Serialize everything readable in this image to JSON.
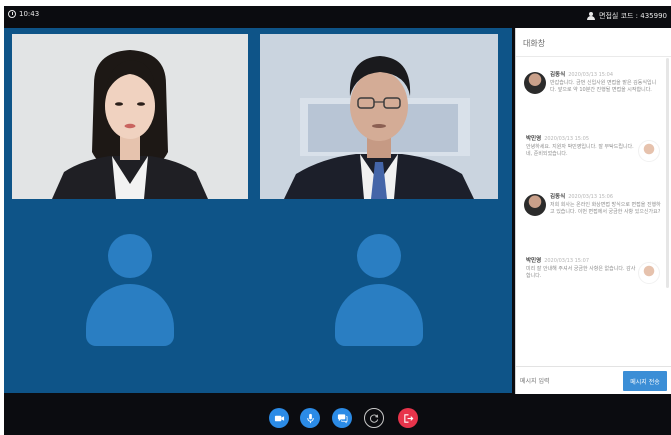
{
  "topbar": {
    "time": "10:43",
    "code": "면접실 코드 : 435990"
  },
  "chat": {
    "title": "대화창",
    "messages": [
      {
        "name": "김동식",
        "time": "2020/03/13 15:04",
        "text": "반갑습니다. 금번 신입사원 면접을 맡은 김동식입니다. 앞으로 약 10분간 진행될 면접을 시작합니다.",
        "side": "left"
      },
      {
        "name": "박민영",
        "time": "2020/03/13 15:05",
        "text": "안녕하세요. 지원자 박민영입니다. 잘 부탁드립니다. 네, 준비되었습니다.",
        "side": "right"
      },
      {
        "name": "김동식",
        "time": "2020/03/13 15:06",
        "text": "저희 회사는 온라인 화상면접 방식으로 면접을 진행하고 있습니다. 이번 면접에서 궁금한 사항 있으신가요?",
        "side": "left"
      },
      {
        "name": "박민영",
        "time": "2020/03/13 15:07",
        "text": "미리 잘 안내해 주셔서 궁금한 사항은 없습니다. 감사합니다.",
        "side": "right"
      }
    ],
    "input_placeholder": "메시지 입력",
    "send_label": "메시지 전송"
  },
  "colors": {
    "stage_bg": "#0e5488",
    "placeholder": "#2a7ec2",
    "control_blue": "#2b8be6",
    "control_red": "#e8344b",
    "send_button": "#3b8ed6"
  },
  "controls": [
    {
      "name": "video-camera-icon"
    },
    {
      "name": "microphone-icon"
    },
    {
      "name": "chat-bubble-icon"
    },
    {
      "name": "record-icon"
    },
    {
      "name": "exit-icon"
    }
  ]
}
